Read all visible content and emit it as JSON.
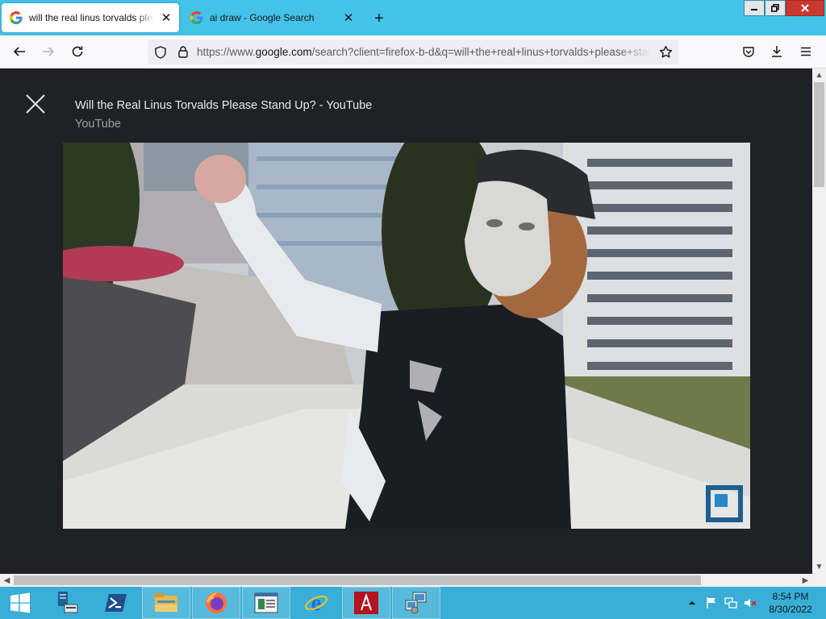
{
  "tabs": [
    {
      "title": "will the real linus torvalds please stand up - Google Search",
      "active": true,
      "favicon": "google-g-icon"
    },
    {
      "title": "ai draw - Google Search",
      "active": false,
      "favicon": "google-g-icon"
    }
  ],
  "tab_close_glyph": "✕",
  "new_tab_glyph": "+",
  "url": {
    "prefix": "https://www.",
    "host": "google.com",
    "path": "/search?client=firefox-b-d&q=will+the+real+linus+torvalds+please+stand+up"
  },
  "viewer": {
    "title": "Will the Real Linus Torvalds Please Stand Up? - YouTube",
    "source": "YouTube"
  },
  "taskbar": {
    "items": [
      "start-icon",
      "server-manager-icon",
      "powershell-icon",
      "file-explorer-icon",
      "firefox-icon",
      "document-app-icon",
      "internet-explorer-icon",
      "red-app-icon",
      "network-app-icon"
    ],
    "clock_time": "8:54 PM",
    "clock_date": "8/30/2022"
  },
  "colors": {
    "titlebar": "#45c2e8",
    "taskbar": "#3aaed6",
    "viewer_bg": "#202124",
    "close_button": "#c7382e"
  }
}
